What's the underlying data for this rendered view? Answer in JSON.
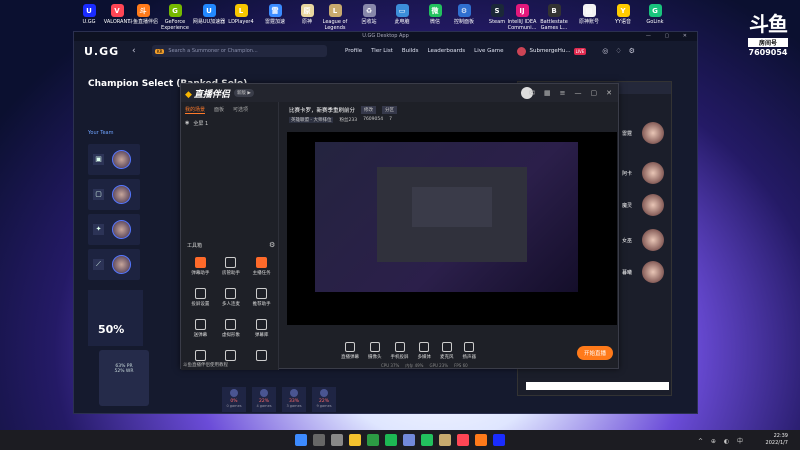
{
  "desktop": {
    "icons": [
      {
        "label": "U.GG",
        "color": "#1a2cff",
        "glyph": "U"
      },
      {
        "label": "VALORANT",
        "color": "#ff4655",
        "glyph": "V"
      },
      {
        "label": "斗鱼直播伴侣",
        "color": "#ff7a1a",
        "glyph": "斗"
      },
      {
        "label": "GeForce Experience",
        "color": "#76b900",
        "glyph": "G"
      },
      {
        "label": "网易UU加速器",
        "color": "#2288ff",
        "glyph": "U"
      },
      {
        "label": "LDPlayer4",
        "color": "#f7c700",
        "glyph": "L"
      },
      {
        "label": "雷霆加速",
        "color": "#3a8bff",
        "glyph": "雷"
      },
      {
        "label": "原神",
        "color": "#e8d7a0",
        "glyph": "原"
      },
      {
        "label": "League of Legends",
        "color": "#c8aa6e",
        "glyph": "L"
      },
      {
        "label": "回收站",
        "color": "#88a",
        "glyph": "♻"
      },
      {
        "label": "此电脑",
        "color": "#3c8ed9",
        "glyph": "▭"
      },
      {
        "label": "微信",
        "color": "#22c15e",
        "glyph": "微"
      },
      {
        "label": "控制面板",
        "color": "#2f6fd0",
        "glyph": "⚙"
      },
      {
        "label": "Steam",
        "color": "#1b2838",
        "glyph": "S"
      },
      {
        "label": "IntelliJ IDEA Communi...",
        "color": "#e3187c",
        "glyph": "IJ"
      },
      {
        "label": "Battlestate Games L...",
        "color": "#333",
        "glyph": "B"
      },
      {
        "label": "原神账号",
        "color": "#f3f3f3",
        "glyph": "▤"
      },
      {
        "label": "YY语音",
        "color": "#ffcc00",
        "glyph": "Y"
      },
      {
        "label": "GoLink",
        "color": "#19c37d",
        "glyph": "G"
      }
    ]
  },
  "watermark": {
    "brand": "斗鱼",
    "sub": "房间号",
    "room": "7609054"
  },
  "ugg": {
    "window_title": "U.GG Desktop App",
    "logo": "U.GG",
    "back": "‹",
    "search_region": "KR",
    "search_placeholder": "Search a Summoner or Champion...",
    "nav": [
      "Profile",
      "Tier List",
      "Builds",
      "Leaderboards",
      "Live Game"
    ],
    "username": "SubmergeHu...",
    "live_badge": "LIVE",
    "page_title": "Champion Select (Ranked Solo)",
    "your_team": "Your Team",
    "winrate": "50%",
    "stat_card": {
      "pct": "63% PR",
      "line": "52% WR"
    },
    "bottom_stats": [
      {
        "pct": "0%",
        "games": "0 games"
      },
      {
        "pct": "22%",
        "games": "4 games"
      },
      {
        "pct": "33%",
        "games": "3 games"
      },
      {
        "pct": "22%",
        "games": "9 games"
      }
    ]
  },
  "zhibo": {
    "logo": "直播伴侣",
    "version": "新版 ▶",
    "side_tabs": [
      "我的场景",
      "面板",
      "可选项"
    ],
    "scene": "全屏 1",
    "tools_title": "工具箱",
    "tools": [
      "弹幕助手",
      "房管助手",
      "主播任务",
      "投屏设置",
      "多人连麦",
      "推荐助手",
      "送弹幕",
      "虚拟形象",
      "弹幕库",
      "",
      "",
      ""
    ],
    "footer_left": "斗鱼直播伴侣使用教程",
    "room_title": "比赛卡罗，新赛季重刷前分",
    "room_btn1": "修改",
    "room_btn2": "分区",
    "info": [
      "英雄联盟 - 大师排位",
      "粉丝233",
      "7609054",
      "7"
    ],
    "actions": [
      "直播弹幕",
      "摄像头",
      "手机投屏",
      "多媒体",
      "麦克风",
      "扬声器"
    ],
    "golive": "开始直播",
    "status": [
      "CPU 37%",
      "内存 49%",
      "GPU 23%",
      "FPS 60"
    ]
  },
  "obs_right": {
    "names": [
      "雷霆",
      "阿卡",
      "魔灵",
      "女巫",
      "暮曦"
    ]
  },
  "taskbar": {
    "clock_time": "22:39",
    "clock_date": "2022/1/7",
    "tray": "^ ⊕ ◐ 中"
  }
}
